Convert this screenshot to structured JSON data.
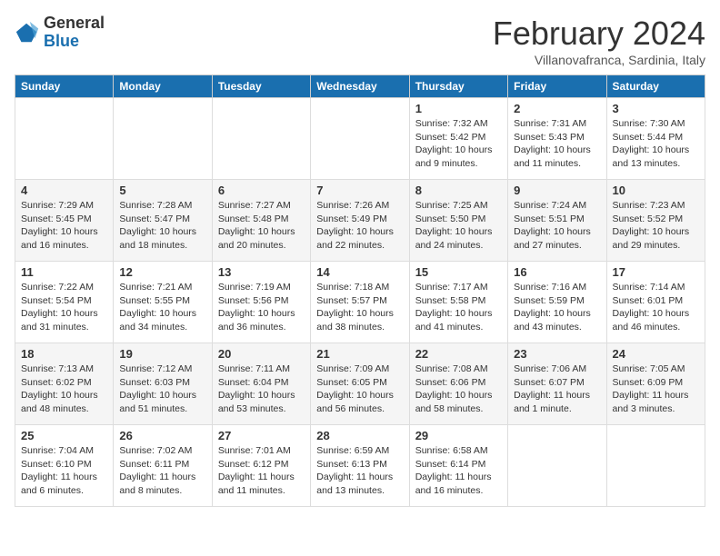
{
  "logo": {
    "general": "General",
    "blue": "Blue"
  },
  "title": "February 2024",
  "subtitle": "Villanovafranca, Sardinia, Italy",
  "days_of_week": [
    "Sunday",
    "Monday",
    "Tuesday",
    "Wednesday",
    "Thursday",
    "Friday",
    "Saturday"
  ],
  "weeks": [
    [
      null,
      null,
      null,
      null,
      {
        "day": "1",
        "sunrise": "7:32 AM",
        "sunset": "5:42 PM",
        "daylight": "10 hours and 9 minutes."
      },
      {
        "day": "2",
        "sunrise": "7:31 AM",
        "sunset": "5:43 PM",
        "daylight": "10 hours and 11 minutes."
      },
      {
        "day": "3",
        "sunrise": "7:30 AM",
        "sunset": "5:44 PM",
        "daylight": "10 hours and 13 minutes."
      }
    ],
    [
      {
        "day": "4",
        "sunrise": "7:29 AM",
        "sunset": "5:45 PM",
        "daylight": "10 hours and 16 minutes."
      },
      {
        "day": "5",
        "sunrise": "7:28 AM",
        "sunset": "5:47 PM",
        "daylight": "10 hours and 18 minutes."
      },
      {
        "day": "6",
        "sunrise": "7:27 AM",
        "sunset": "5:48 PM",
        "daylight": "10 hours and 20 minutes."
      },
      {
        "day": "7",
        "sunrise": "7:26 AM",
        "sunset": "5:49 PM",
        "daylight": "10 hours and 22 minutes."
      },
      {
        "day": "8",
        "sunrise": "7:25 AM",
        "sunset": "5:50 PM",
        "daylight": "10 hours and 24 minutes."
      },
      {
        "day": "9",
        "sunrise": "7:24 AM",
        "sunset": "5:51 PM",
        "daylight": "10 hours and 27 minutes."
      },
      {
        "day": "10",
        "sunrise": "7:23 AM",
        "sunset": "5:52 PM",
        "daylight": "10 hours and 29 minutes."
      }
    ],
    [
      {
        "day": "11",
        "sunrise": "7:22 AM",
        "sunset": "5:54 PM",
        "daylight": "10 hours and 31 minutes."
      },
      {
        "day": "12",
        "sunrise": "7:21 AM",
        "sunset": "5:55 PM",
        "daylight": "10 hours and 34 minutes."
      },
      {
        "day": "13",
        "sunrise": "7:19 AM",
        "sunset": "5:56 PM",
        "daylight": "10 hours and 36 minutes."
      },
      {
        "day": "14",
        "sunrise": "7:18 AM",
        "sunset": "5:57 PM",
        "daylight": "10 hours and 38 minutes."
      },
      {
        "day": "15",
        "sunrise": "7:17 AM",
        "sunset": "5:58 PM",
        "daylight": "10 hours and 41 minutes."
      },
      {
        "day": "16",
        "sunrise": "7:16 AM",
        "sunset": "5:59 PM",
        "daylight": "10 hours and 43 minutes."
      },
      {
        "day": "17",
        "sunrise": "7:14 AM",
        "sunset": "6:01 PM",
        "daylight": "10 hours and 46 minutes."
      }
    ],
    [
      {
        "day": "18",
        "sunrise": "7:13 AM",
        "sunset": "6:02 PM",
        "daylight": "10 hours and 48 minutes."
      },
      {
        "day": "19",
        "sunrise": "7:12 AM",
        "sunset": "6:03 PM",
        "daylight": "10 hours and 51 minutes."
      },
      {
        "day": "20",
        "sunrise": "7:11 AM",
        "sunset": "6:04 PM",
        "daylight": "10 hours and 53 minutes."
      },
      {
        "day": "21",
        "sunrise": "7:09 AM",
        "sunset": "6:05 PM",
        "daylight": "10 hours and 56 minutes."
      },
      {
        "day": "22",
        "sunrise": "7:08 AM",
        "sunset": "6:06 PM",
        "daylight": "10 hours and 58 minutes."
      },
      {
        "day": "23",
        "sunrise": "7:06 AM",
        "sunset": "6:07 PM",
        "daylight": "11 hours and 1 minute."
      },
      {
        "day": "24",
        "sunrise": "7:05 AM",
        "sunset": "6:09 PM",
        "daylight": "11 hours and 3 minutes."
      }
    ],
    [
      {
        "day": "25",
        "sunrise": "7:04 AM",
        "sunset": "6:10 PM",
        "daylight": "11 hours and 6 minutes."
      },
      {
        "day": "26",
        "sunrise": "7:02 AM",
        "sunset": "6:11 PM",
        "daylight": "11 hours and 8 minutes."
      },
      {
        "day": "27",
        "sunrise": "7:01 AM",
        "sunset": "6:12 PM",
        "daylight": "11 hours and 11 minutes."
      },
      {
        "day": "28",
        "sunrise": "6:59 AM",
        "sunset": "6:13 PM",
        "daylight": "11 hours and 13 minutes."
      },
      {
        "day": "29",
        "sunrise": "6:58 AM",
        "sunset": "6:14 PM",
        "daylight": "11 hours and 16 minutes."
      },
      null,
      null
    ]
  ]
}
